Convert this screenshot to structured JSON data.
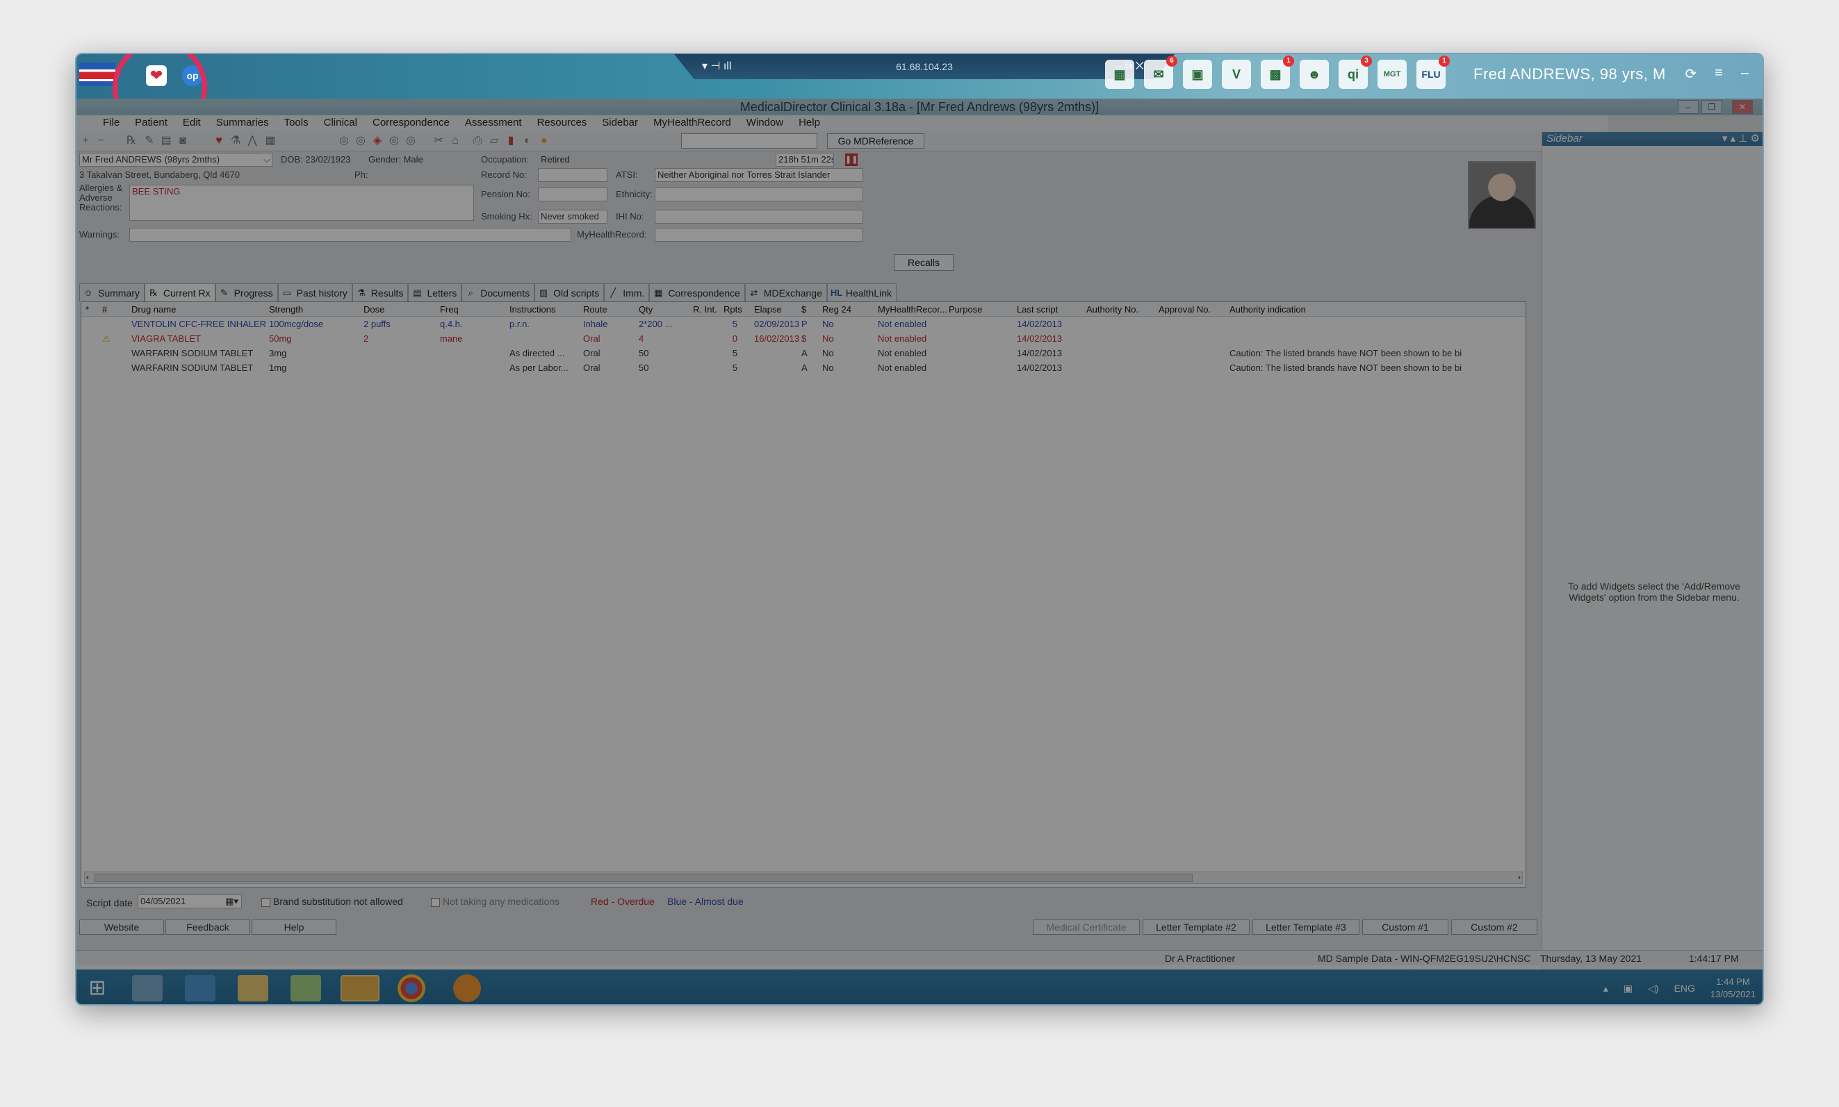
{
  "remote": {
    "ip": "61.68.104.23",
    "patient_banner": "Fred ANDREWS, 98 yrs, M",
    "app_badges": [
      "6",
      "1",
      "3",
      "1"
    ],
    "app_icon_labels": [
      "qi",
      "MGT",
      "FLU"
    ],
    "op_icon": "op"
  },
  "window": {
    "title": "MedicalDirector Clinical 3.18a - [Mr Fred Andrews (98yrs 2mths)]"
  },
  "menu": [
    "File",
    "Patient",
    "Edit",
    "Summaries",
    "Tools",
    "Clinical",
    "Correspondence",
    "Assessment",
    "Resources",
    "Sidebar",
    "MyHealthRecord",
    "Window",
    "Help"
  ],
  "toolbar": {
    "md_reference_label": "Go MDReference",
    "search_value": ""
  },
  "patient": {
    "name_select": "Mr Fred ANDREWS (98yrs 2mths)",
    "dob": "DOB: 23/02/1923",
    "gender": "Gender: Male",
    "occupation_label": "Occupation:",
    "occupation": "Retired",
    "timer": "218h 51m 22s",
    "address": "3 Takalvan Street, Bundaberg, Qld  4670",
    "phone_label": "Ph:",
    "record_label": "Record No:",
    "atsi_label": "ATSI:",
    "atsi": "Neither Aboriginal nor Torres Strait Islander",
    "allergies_label": "Allergies & Adverse Reactions:",
    "allergies": "BEE STING",
    "pension_label": "Pension No:",
    "ethnicity_label": "Ethnicity:",
    "smoking_label": "Smoking Hx:",
    "smoking": "Never smoked",
    "ihi_label": "IHI No:",
    "warnings_label": "Warnings:",
    "myhealth_label": "MyHealthRecord:",
    "recalls_label": "Recalls"
  },
  "tabs": [
    {
      "label": "Summary",
      "icon": "smiley-icon"
    },
    {
      "label": "Current Rx",
      "icon": "rx-icon"
    },
    {
      "label": "Progress",
      "icon": "pen-icon"
    },
    {
      "label": "Past history",
      "icon": "folder-icon"
    },
    {
      "label": "Results",
      "icon": "flask-icon"
    },
    {
      "label": "Letters",
      "icon": "letter-icon"
    },
    {
      "label": "Documents",
      "icon": "clip-icon"
    },
    {
      "label": "Old scripts",
      "icon": "book-icon"
    },
    {
      "label": "Imm.",
      "icon": "syringe-icon"
    },
    {
      "label": "Correspondence",
      "icon": "mail-icon"
    },
    {
      "label": "MDExchange",
      "icon": "exchange-icon"
    },
    {
      "label": "HealthLink",
      "icon": "hl-icon"
    }
  ],
  "grid": {
    "columns": [
      "*",
      "#",
      "Drug name",
      "Strength",
      "Dose",
      "Freq",
      "Instructions",
      "Route",
      "Qty",
      "R. Int.",
      "Rpts",
      "Elapse",
      "$",
      "Reg 24",
      "MyHealthRecor...",
      "Purpose",
      "Last script",
      "Authority No.",
      "Approval No.",
      "Authority indication"
    ],
    "rows": [
      {
        "status": "blue",
        "flag": "",
        "drug": "VENTOLIN CFC-FREE INHALER",
        "strength": "100mcg/dose",
        "dose": "2 puffs",
        "freq": "q.4.h.",
        "instructions": "p.r.n.",
        "route": "Inhale",
        "qty": "2*200 ...",
        "rint": "",
        "rpts": "5",
        "elapse": "02/09/2013",
        "price": "P",
        "reg24": "No",
        "mhr": "Not enabled",
        "purpose": "",
        "last": "14/02/2013",
        "auth_no": "",
        "approval": "",
        "indication": ""
      },
      {
        "status": "red",
        "flag": "⚠",
        "drug": "VIAGRA TABLET",
        "strength": "50mg",
        "dose": "2",
        "freq": "mane",
        "instructions": "",
        "route": "Oral",
        "qty": "4",
        "rint": "",
        "rpts": "0",
        "elapse": "16/02/2013",
        "price": "$",
        "reg24": "No",
        "mhr": "Not enabled",
        "purpose": "",
        "last": "14/02/2013",
        "auth_no": "",
        "approval": "",
        "indication": ""
      },
      {
        "status": "black",
        "flag": "",
        "drug": "WARFARIN SODIUM TABLET",
        "strength": "3mg",
        "dose": "",
        "freq": "",
        "instructions": "As directed ...",
        "route": "Oral",
        "qty": "50",
        "rint": "",
        "rpts": "5",
        "elapse": "",
        "price": "A",
        "reg24": "No",
        "mhr": "Not enabled",
        "purpose": "",
        "last": "14/02/2013",
        "auth_no": "",
        "approval": "",
        "indication": "Caution: The listed brands have NOT been shown to be bi"
      },
      {
        "status": "black",
        "flag": "",
        "drug": "WARFARIN SODIUM TABLET",
        "strength": "1mg",
        "dose": "",
        "freq": "",
        "instructions": "As per Labor...",
        "route": "Oral",
        "qty": "50",
        "rint": "",
        "rpts": "5",
        "elapse": "",
        "price": "A",
        "reg24": "No",
        "mhr": "Not enabled",
        "purpose": "",
        "last": "14/02/2013",
        "auth_no": "",
        "approval": "",
        "indication": "Caution: The listed brands have NOT been shown to be bi"
      }
    ]
  },
  "bottom": {
    "script_date_label": "Script date",
    "script_date": "04/05/2021",
    "brand_sub": "Brand substitution not allowed",
    "not_taking": "Not taking any medications",
    "legend_red": "Red - Overdue",
    "legend_blue": "Blue - Almost due",
    "buttons_left": [
      "Website",
      "Feedback",
      "Help"
    ],
    "buttons_right": [
      "Medical Certificate",
      "Letter Template #2",
      "Letter Template #3",
      "Custom #1",
      "Custom #2"
    ]
  },
  "sidebar": {
    "title": "Sidebar",
    "message": "To add Widgets select the 'Add/Remove Widgets' option from the Sidebar menu."
  },
  "status": {
    "practitioner": "Dr A Practitioner",
    "database": "MD Sample Data - WIN-QFM2EG19SU2\\HCNSC",
    "date": "Thursday, 13 May 2021",
    "time": "1:44:17 PM"
  },
  "taskbar": {
    "tray_lang": "ENG",
    "clock_time": "1:44 PM",
    "clock_date": "13/05/2021"
  },
  "colors": {
    "overdue": "#b5151b",
    "almost_due": "#1a34a6",
    "highlight": "#e52a59"
  }
}
